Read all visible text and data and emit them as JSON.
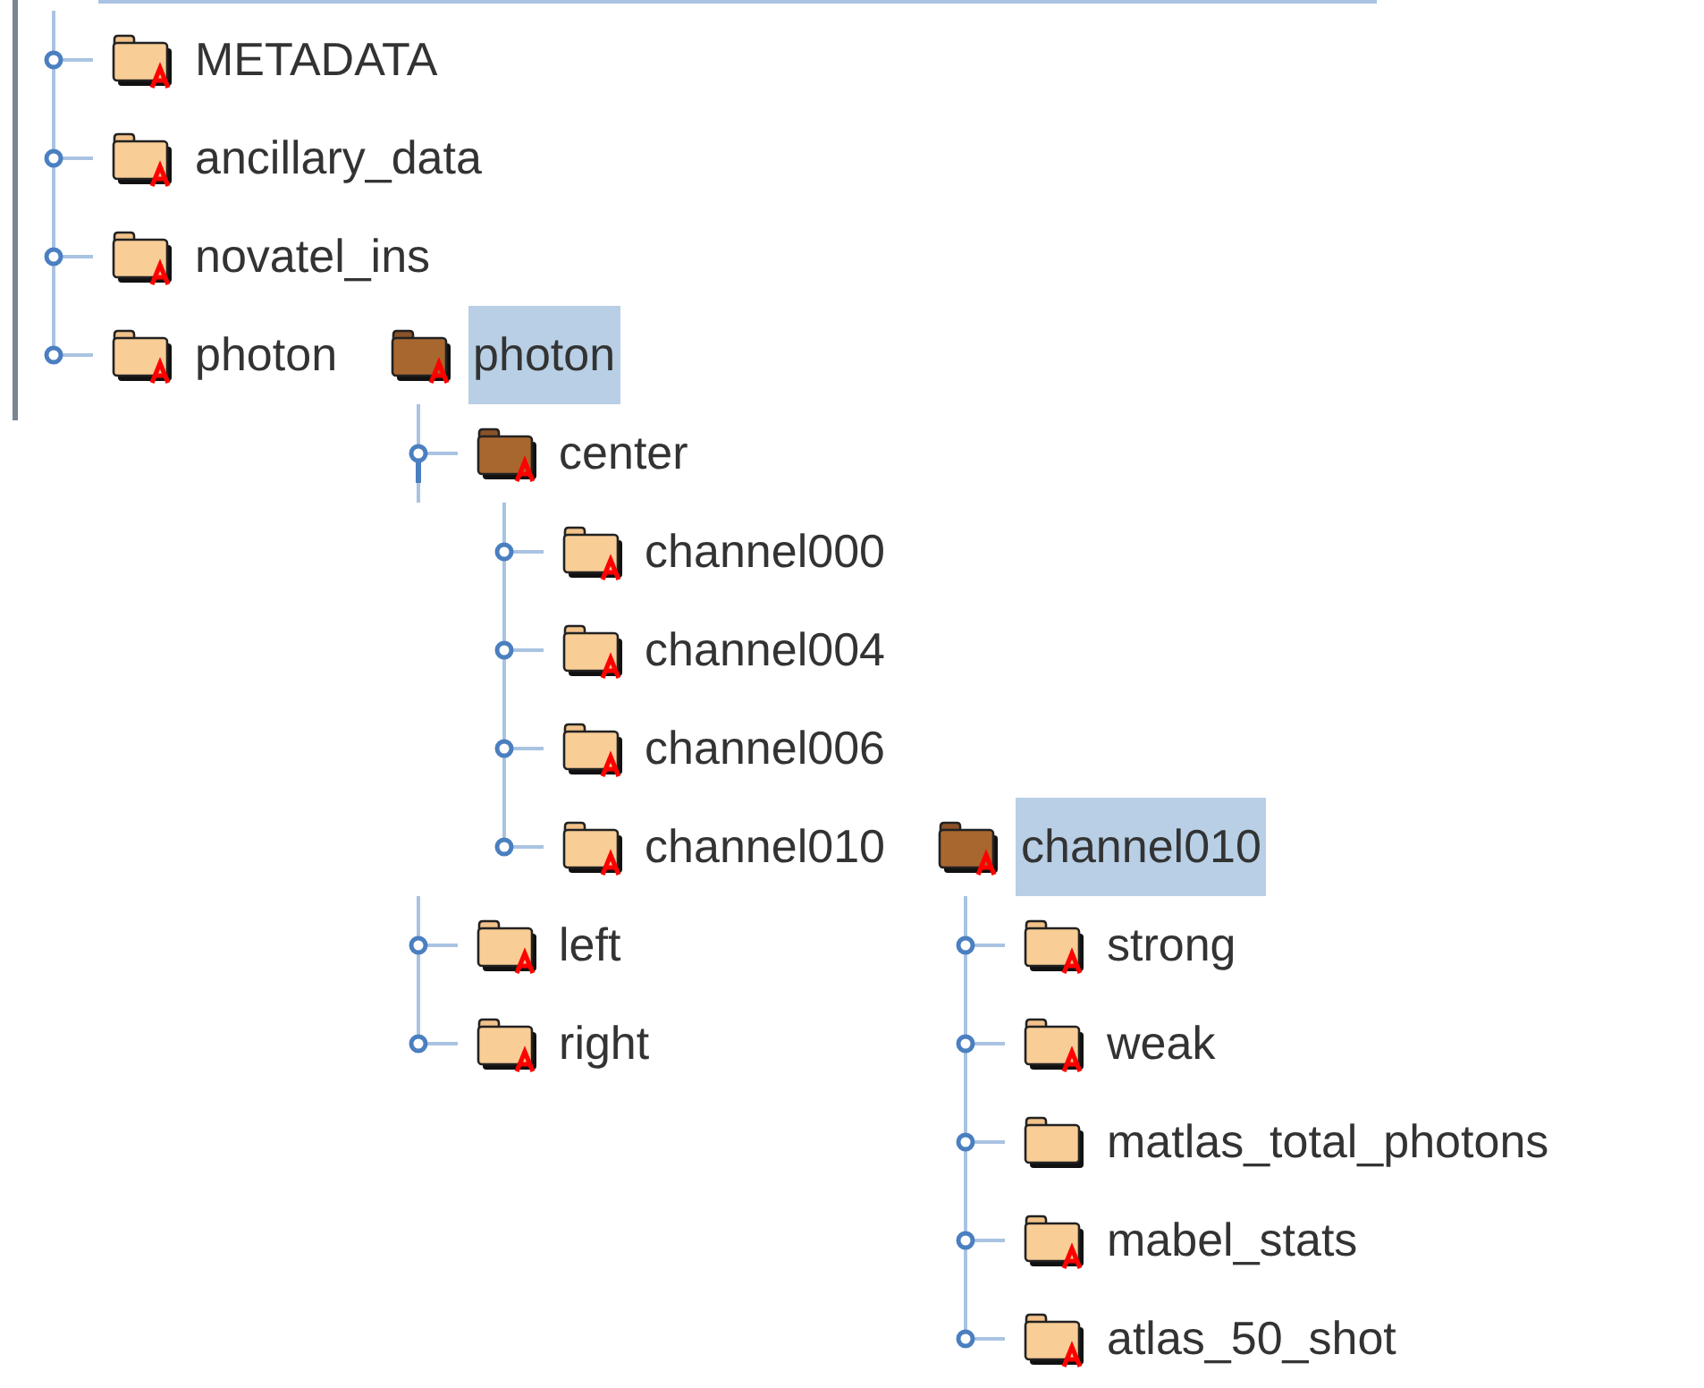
{
  "tree": [
    {
      "label": "METADATA",
      "attributes": true,
      "expanded": false,
      "selected": false
    },
    {
      "label": "ancillary_data",
      "attributes": true,
      "expanded": false,
      "selected": false
    },
    {
      "label": "novatel_ins",
      "attributes": true,
      "expanded": false,
      "selected": false
    },
    {
      "label": "photon",
      "attributes": true,
      "expanded": false,
      "selected": false,
      "detail": {
        "label": "photon",
        "attributes": true,
        "selected": true,
        "children": [
          {
            "label": "center",
            "attributes": true,
            "expanded": true,
            "selected": false,
            "children": [
              {
                "label": "channel000",
                "attributes": true,
                "expanded": false,
                "selected": false
              },
              {
                "label": "channel004",
                "attributes": true,
                "expanded": false,
                "selected": false
              },
              {
                "label": "channel006",
                "attributes": true,
                "expanded": false,
                "selected": false
              },
              {
                "label": "channel010",
                "attributes": true,
                "expanded": false,
                "selected": false,
                "detail": {
                  "label": "channel010",
                  "attributes": true,
                  "selected": true,
                  "children": [
                    {
                      "label": "strong",
                      "attributes": true,
                      "expanded": false,
                      "selected": false
                    },
                    {
                      "label": "weak",
                      "attributes": true,
                      "expanded": false,
                      "selected": false
                    },
                    {
                      "label": "matlas_total_photons",
                      "attributes": false,
                      "expanded": false,
                      "selected": false
                    },
                    {
                      "label": "mabel_stats",
                      "attributes": true,
                      "expanded": false,
                      "selected": false
                    },
                    {
                      "label": "atlas_50_shot",
                      "attributes": true,
                      "expanded": false,
                      "selected": false
                    }
                  ]
                }
              }
            ]
          },
          {
            "label": "left",
            "attributes": true,
            "expanded": false,
            "selected": false
          },
          {
            "label": "right",
            "attributes": true,
            "expanded": false,
            "selected": false
          }
        ]
      }
    }
  ]
}
